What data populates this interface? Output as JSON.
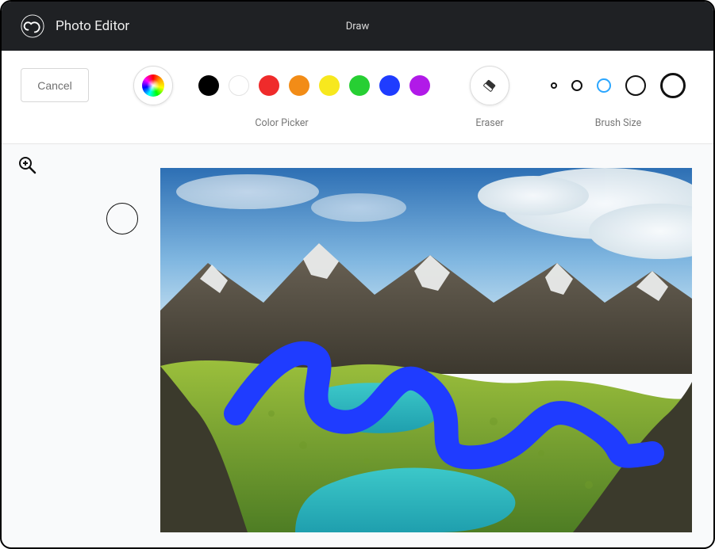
{
  "header": {
    "app_title": "Photo Editor",
    "mode": "Draw"
  },
  "toolbar": {
    "cancel_label": "Cancel",
    "color_picker_label": "Color Picker",
    "eraser_label": "Eraser",
    "brush_size_label": "Brush Size",
    "colors": {
      "black": "#000000",
      "white": "#ffffff",
      "red": "#ef2b2b",
      "orange": "#f28c17",
      "yellow": "#f7e81e",
      "green": "#27cf33",
      "blue": "#1f3cff",
      "purple": "#b11ae8"
    },
    "brush_sizes": [
      1,
      2,
      3,
      4,
      5
    ],
    "selected_brush_index": 2
  },
  "canvas": {
    "stroke_color": "#1f3cff"
  }
}
